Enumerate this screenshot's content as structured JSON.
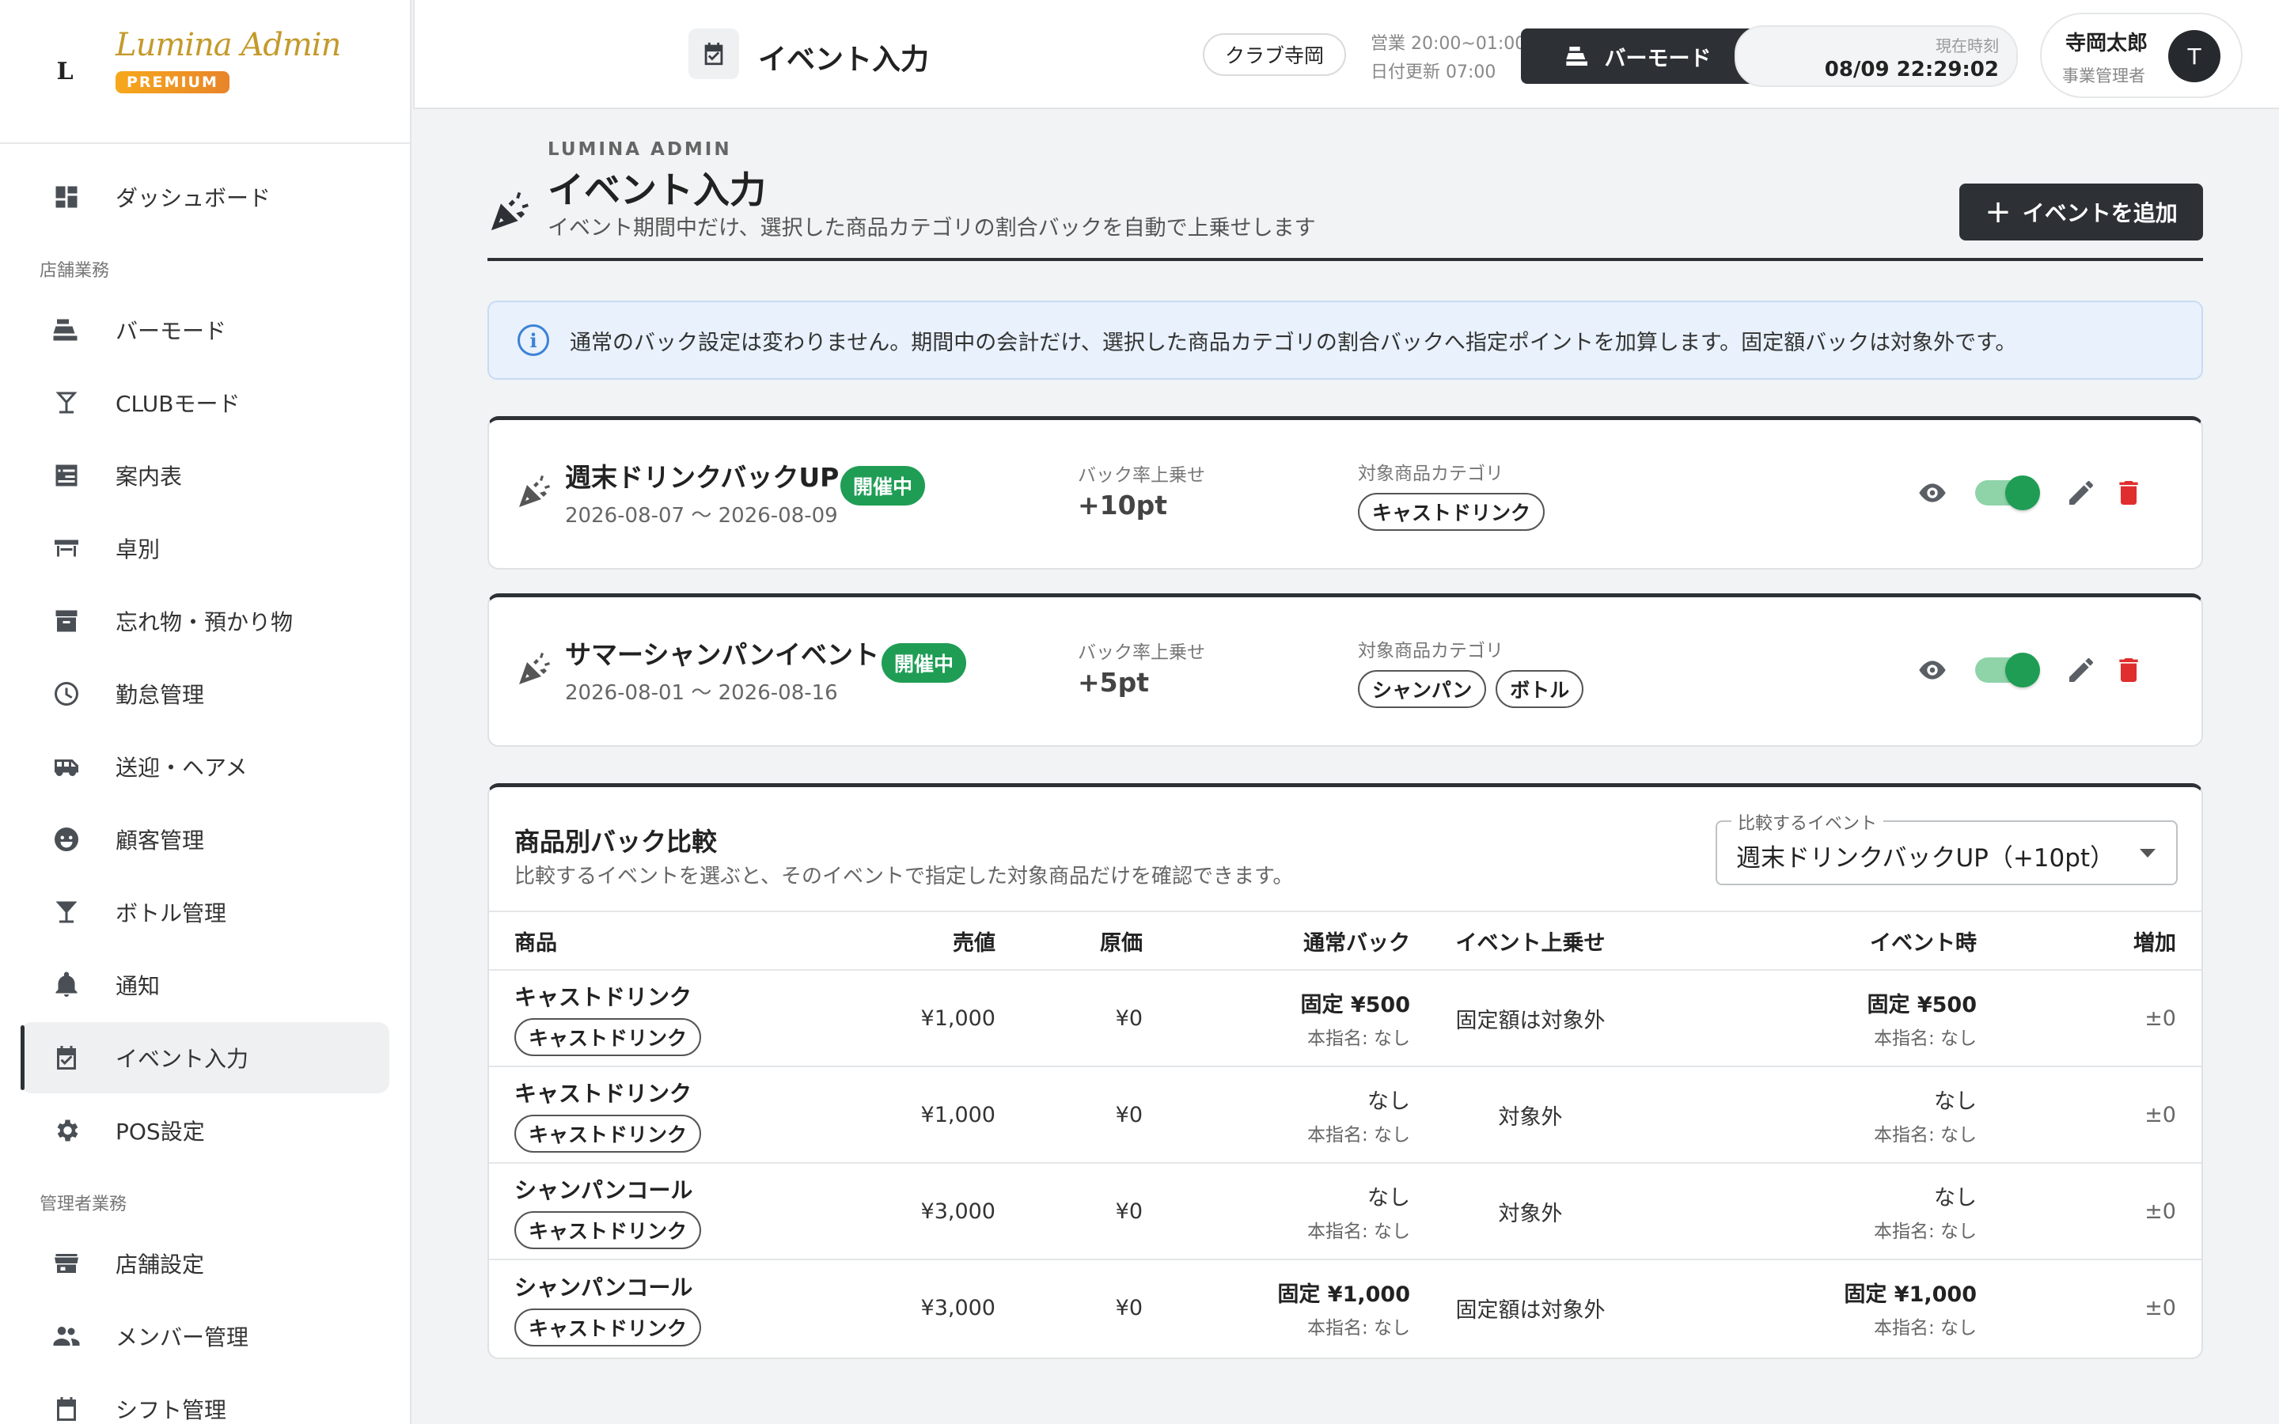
{
  "brand": {
    "logo_letter": "L",
    "name": "Lumina Admin",
    "badge": "PREMIUM"
  },
  "sidebar": {
    "items_top": [
      {
        "name": "dashboard",
        "label": "ダッシュボード",
        "icon": "dashboard-icon"
      }
    ],
    "section1": "店舗業務",
    "items_store": [
      {
        "name": "bar-mode",
        "label": "バーモード",
        "icon": "register-icon"
      },
      {
        "name": "club-mode",
        "label": "CLUBモード",
        "icon": "cocktail-icon"
      },
      {
        "name": "guide-table",
        "label": "案内表",
        "icon": "checklist-icon"
      },
      {
        "name": "table-view",
        "label": "卓別",
        "icon": "table-icon"
      },
      {
        "name": "lost-items",
        "label": "忘れ物・預かり物",
        "icon": "archive-icon"
      },
      {
        "name": "attendance",
        "label": "勤怠管理",
        "icon": "clock-icon"
      },
      {
        "name": "pickup",
        "label": "送迎・ヘアメ",
        "icon": "bus-icon"
      },
      {
        "name": "customers",
        "label": "顧客管理",
        "icon": "face-icon"
      },
      {
        "name": "bottles",
        "label": "ボトル管理",
        "icon": "glass-icon"
      },
      {
        "name": "notifications",
        "label": "通知",
        "icon": "bell-icon"
      },
      {
        "name": "event-input",
        "label": "イベント入力",
        "icon": "calendar-check-icon",
        "active": true
      },
      {
        "name": "pos-settings",
        "label": "POS設定",
        "icon": "gear-icon"
      }
    ],
    "section2": "管理者業務",
    "items_admin": [
      {
        "name": "store-settings",
        "label": "店舗設定",
        "icon": "store-icon"
      },
      {
        "name": "members",
        "label": "メンバー管理",
        "icon": "people-icon"
      },
      {
        "name": "shifts",
        "label": "シフト管理",
        "icon": "calendar-icon"
      }
    ]
  },
  "topbar": {
    "title": "イベント入力",
    "store_chip": "クラブ寺岡",
    "hours": "営業 20:00~01:00",
    "date_update": "日付更新 07:00",
    "barmode_label": "バーモード",
    "clock_label": "現在時刻",
    "clock_time": "08/09 22:29:02",
    "user_name": "寺岡太郎",
    "user_role": "事業管理者",
    "avatar_letter": "T"
  },
  "page": {
    "kicker": "LUMINA ADMIN",
    "title": "イベント入力",
    "subtitle": "イベント期間中だけ、選択した商品カテゴリの割合バックを自動で上乗せします",
    "add_button": "イベントを追加",
    "info": "通常のバック設定は変わりません。期間中の会計だけ、選択した商品カテゴリの割合バックへ指定ポイントを加算します。固定額バックは対象外です。"
  },
  "events": [
    {
      "name": "週末ドリンクバックUP",
      "status": "開催中",
      "dates": "2026-08-07 〜 2026-08-09",
      "rate_label": "バック率上乗せ",
      "rate": "+10pt",
      "category_label": "対象商品カテゴリ",
      "categories": [
        "キャストドリンク"
      ],
      "enabled": true
    },
    {
      "name": "サマーシャンパンイベント",
      "status": "開催中",
      "dates": "2026-08-01 〜 2026-08-16",
      "rate_label": "バック率上乗せ",
      "rate": "+5pt",
      "category_label": "対象商品カテゴリ",
      "categories": [
        "シャンパン",
        "ボトル"
      ],
      "enabled": true
    }
  ],
  "comparison": {
    "title": "商品別バック比較",
    "subtitle": "比較するイベントを選ぶと、そのイベントで指定した対象商品だけを確認できます。",
    "select_legend": "比較するイベント",
    "select_value": "週末ドリンクバックUP（+10pt）",
    "headers": [
      "商品",
      "売値",
      "原価",
      "通常バック",
      "イベント上乗せ",
      "イベント時",
      "増加"
    ],
    "rows": [
      {
        "product": "キャストドリンク",
        "tag": "キャストドリンク",
        "price": "¥1,000",
        "cost": "¥0",
        "normal": "固定 ¥500",
        "normal_bold": true,
        "normal_sub": "本指名: なし",
        "extra": "固定額は対象外",
        "event": "固定 ¥500",
        "event_bold": true,
        "event_sub": "本指名: なし",
        "increase": "±0"
      },
      {
        "product": "キャストドリンク",
        "tag": "キャストドリンク",
        "price": "¥1,000",
        "cost": "¥0",
        "normal": "なし",
        "normal_bold": false,
        "normal_sub": "本指名: なし",
        "extra": "対象外",
        "event": "なし",
        "event_bold": false,
        "event_sub": "本指名: なし",
        "increase": "±0"
      },
      {
        "product": "シャンパンコール",
        "tag": "キャストドリンク",
        "price": "¥3,000",
        "cost": "¥0",
        "normal": "なし",
        "normal_bold": false,
        "normal_sub": "本指名: なし",
        "extra": "対象外",
        "event": "なし",
        "event_bold": false,
        "event_sub": "本指名: なし",
        "increase": "±0"
      },
      {
        "product": "シャンパンコール",
        "tag": "キャストドリンク",
        "price": "¥3,000",
        "cost": "¥0",
        "normal": "固定 ¥1,000",
        "normal_bold": true,
        "normal_sub": "本指名: なし",
        "extra": "固定額は対象外",
        "event": "固定 ¥1,000",
        "event_bold": true,
        "event_sub": "本指名: なし",
        "increase": "±0"
      }
    ]
  }
}
